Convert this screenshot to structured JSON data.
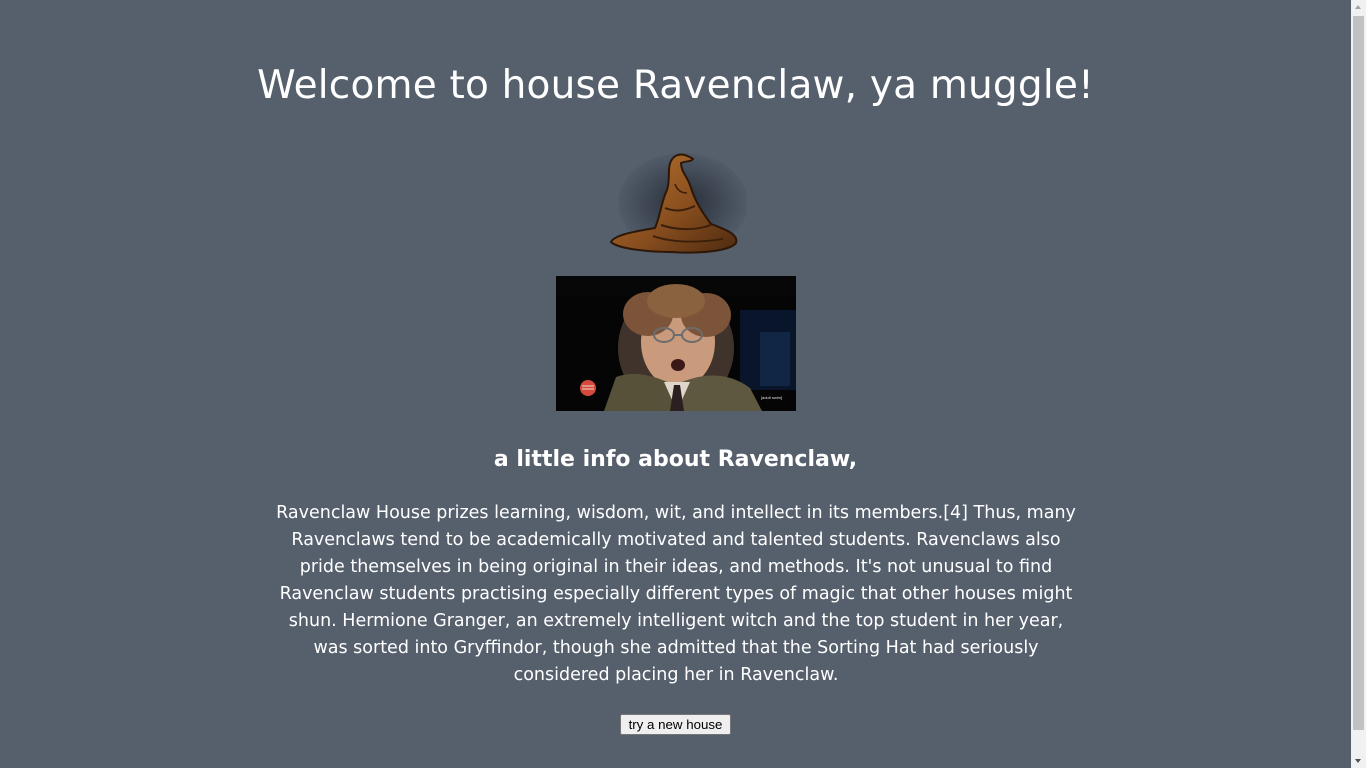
{
  "header": {
    "title": "Welcome to house Ravenclaw, ya muggle!"
  },
  "images": {
    "hat_icon": "sorting-hat-icon",
    "gif_icon": "reaction-gif"
  },
  "info": {
    "heading": "a little info about Ravenclaw,",
    "paragraph": "Ravenclaw House prizes learning, wisdom, wit, and intellect in its members.[4] Thus, many Ravenclaws tend to be academically motivated and talented students. Ravenclaws also pride themselves in being original in their ideas, and methods. It's not unusual to find Ravenclaw students practising especially different types of magic that other houses might shun. Hermione Granger, an extremely intelligent witch and the top student in her year, was sorted into Gryffindor, though she admitted that the Sorting Hat had seriously considered placing her in Ravenclaw."
  },
  "actions": {
    "try_new_house_label": "try a new house"
  },
  "colors": {
    "background": "#56606d",
    "text": "#ffffff"
  }
}
